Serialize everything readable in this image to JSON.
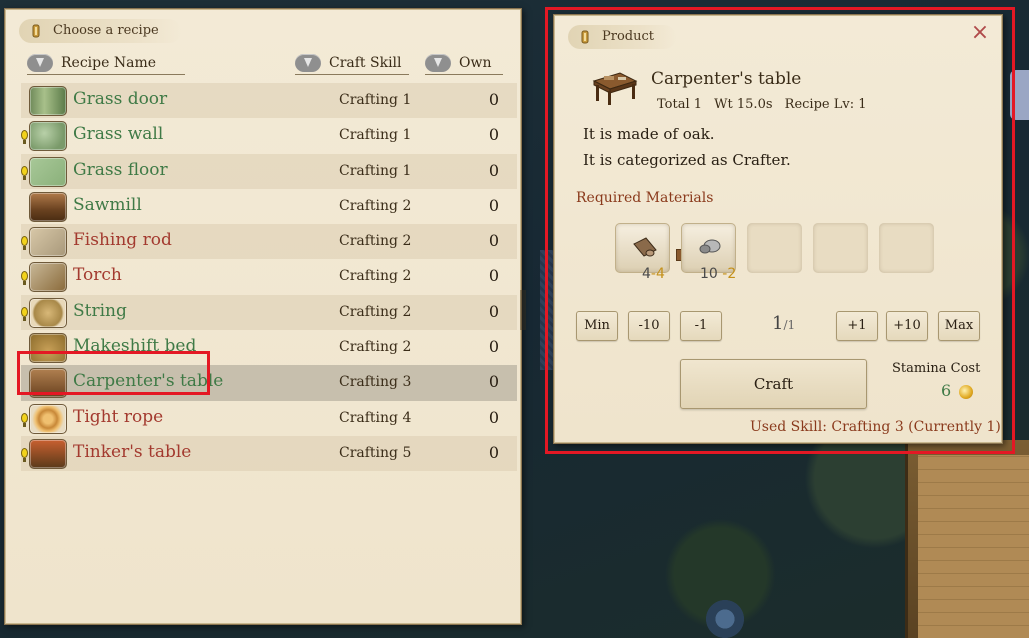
{
  "recipe_panel": {
    "title": "Choose a recipe",
    "columns": {
      "name": "Recipe Name",
      "skill": "Craft Skill",
      "own": "Own"
    },
    "recipes": [
      {
        "name": "Grass door",
        "skill": "Crafting 1",
        "own": "0",
        "color": "green",
        "hint": false,
        "icon": "grass-door-icon"
      },
      {
        "name": "Grass wall",
        "skill": "Crafting 1",
        "own": "0",
        "color": "green",
        "hint": true,
        "icon": "grass-wall-icon"
      },
      {
        "name": "Grass floor",
        "skill": "Crafting 1",
        "own": "0",
        "color": "green",
        "hint": true,
        "icon": "grass-floor-icon"
      },
      {
        "name": "Sawmill",
        "skill": "Crafting 2",
        "own": "0",
        "color": "green",
        "hint": false,
        "icon": "sawmill-icon"
      },
      {
        "name": "Fishing rod",
        "skill": "Crafting 2",
        "own": "0",
        "color": "red",
        "hint": true,
        "icon": "fishing-rod-icon"
      },
      {
        "name": "Torch",
        "skill": "Crafting 2",
        "own": "0",
        "color": "red",
        "hint": true,
        "icon": "torch-icon"
      },
      {
        "name": "String",
        "skill": "Crafting 2",
        "own": "0",
        "color": "green",
        "hint": true,
        "icon": "string-icon"
      },
      {
        "name": "Makeshift bed",
        "skill": "Crafting 2",
        "own": "0",
        "color": "green",
        "hint": false,
        "icon": "makeshift-bed-icon"
      },
      {
        "name": "Carpenter's table",
        "skill": "Crafting 3",
        "own": "0",
        "color": "green",
        "hint": false,
        "icon": "carpenters-table-icon",
        "selected": true
      },
      {
        "name": "Tight rope",
        "skill": "Crafting 4",
        "own": "0",
        "color": "red",
        "hint": true,
        "icon": "tight-rope-icon"
      },
      {
        "name": "Tinker's table",
        "skill": "Crafting 5",
        "own": "0",
        "color": "red",
        "hint": true,
        "icon": "tinkers-table-icon"
      }
    ]
  },
  "product_panel": {
    "title": "Product",
    "close_label": "×",
    "name": "Carpenter's table",
    "total": "Total 1",
    "weight": "Wt 15.0s",
    "recipe_level": "Recipe Lv: 1",
    "description": [
      "It is made of oak.",
      "It is categorized as Crafter."
    ],
    "required_label": "Required Materials",
    "materials": [
      {
        "icon": "log-icon",
        "have": "4",
        "need": "-4"
      },
      {
        "icon": "stone-icon",
        "have": "10",
        "need": "-2"
      }
    ],
    "qty_buttons": {
      "min": "Min",
      "minus10": "-10",
      "minus1": "-1",
      "plus1": "+1",
      "plus10": "+10",
      "max": "Max"
    },
    "qty_current": "1",
    "qty_max": "/1",
    "craft_label": "Craft",
    "stamina_label": "Stamina Cost",
    "stamina_value": "6",
    "used_skill": "Used Skill: Crafting 3 (Currently 1)"
  },
  "colors": {
    "highlight": "#e41824",
    "available_green": "#3f7a46",
    "unavailable_red": "#a33a2f",
    "parchment": "#f3ead6"
  }
}
